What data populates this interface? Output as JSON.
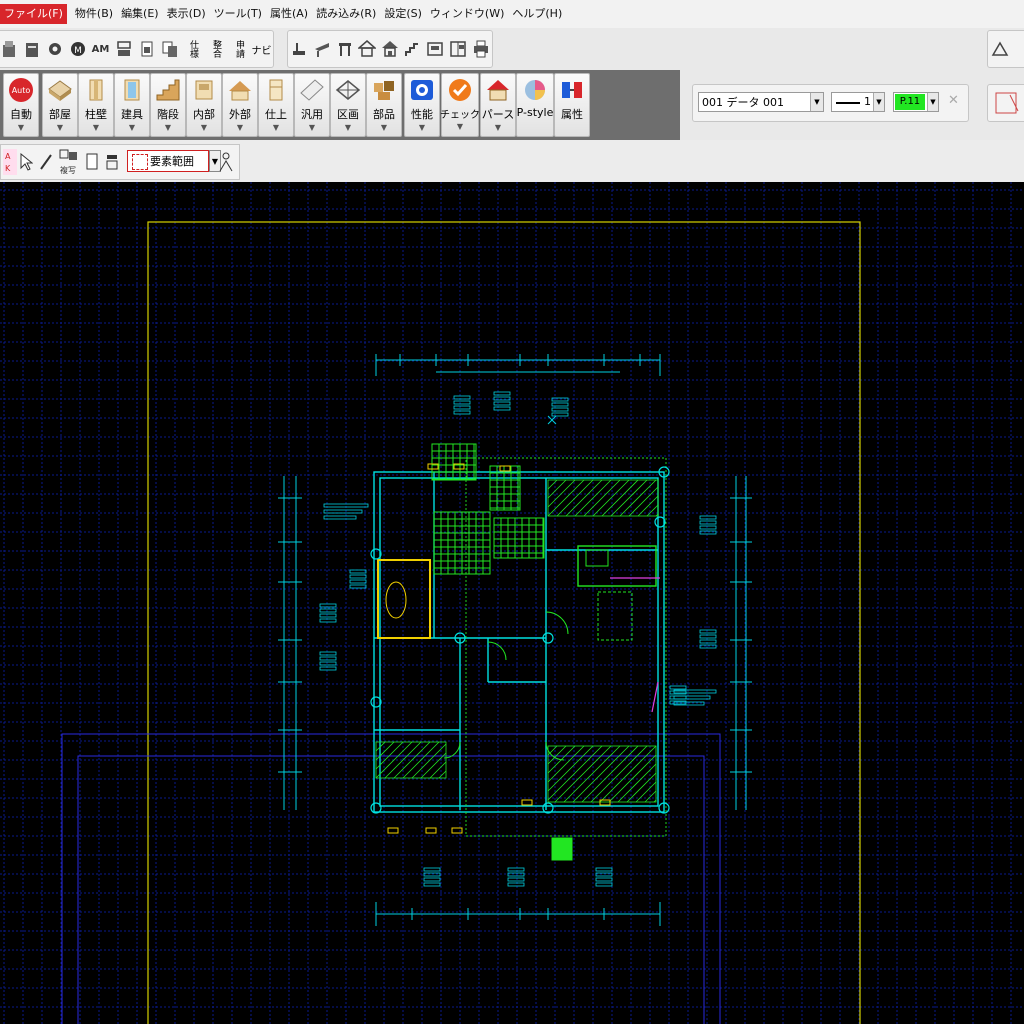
{
  "menu": {
    "items": [
      {
        "label": "ファイル(F)",
        "active": true
      },
      {
        "label": "物件(B)"
      },
      {
        "label": "編集(E)"
      },
      {
        "label": "表示(D)"
      },
      {
        "label": "ツール(T)"
      },
      {
        "label": "属性(A)"
      },
      {
        "label": "読み込み(R)"
      },
      {
        "label": "設定(S)"
      },
      {
        "label": "ウィンドウ(W)"
      },
      {
        "label": "ヘルプ(H)"
      }
    ]
  },
  "toolbar1": {
    "am_label": "AM",
    "shiyou_label": "仕様",
    "seigo_label": "整合",
    "shinsei_label": "申請",
    "navi_label": "ナビ"
  },
  "toolbar2": {
    "buttons": [
      {
        "label": "自動",
        "icon": "auto-icon"
      },
      {
        "label": "部屋",
        "icon": "room-icon"
      },
      {
        "label": "柱壁",
        "icon": "column-wall-icon"
      },
      {
        "label": "建具",
        "icon": "fitting-icon"
      },
      {
        "label": "階段",
        "icon": "stairs-icon"
      },
      {
        "label": "内部",
        "icon": "interior-icon"
      },
      {
        "label": "外部",
        "icon": "exterior-icon"
      },
      {
        "label": "仕上",
        "icon": "finish-icon"
      },
      {
        "label": "汎用",
        "icon": "general-icon"
      },
      {
        "label": "区画",
        "icon": "section-icon"
      },
      {
        "label": "部品",
        "icon": "parts-icon"
      },
      {
        "label": "性能",
        "icon": "performance-icon"
      },
      {
        "label": "チェック",
        "icon": "check-icon"
      },
      {
        "label": "パース",
        "icon": "perspective-icon"
      },
      {
        "label": "P-style",
        "icon": "pstyle-icon"
      },
      {
        "label": "属性",
        "icon": "attribute-icon"
      }
    ],
    "auto_badge": "Auto",
    "layer_value": "001  データ 001",
    "line_width": "1",
    "color_value": "P.11",
    "color_hex": "#22e622"
  },
  "toolbar3": {
    "range_label": "要素範囲"
  },
  "canvas": {
    "background": "#000000",
    "grid_color": "#0a1a8c",
    "frame_color": "#d6d200"
  }
}
